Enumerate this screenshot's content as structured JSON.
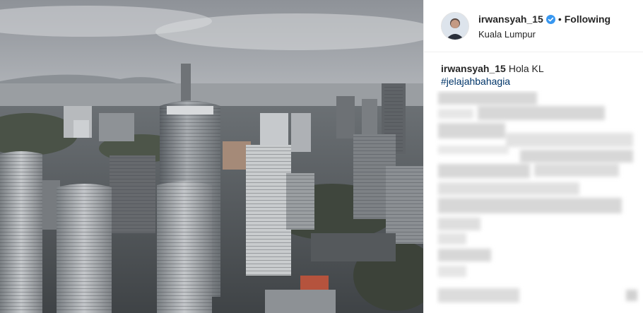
{
  "post": {
    "username": "irwansyah_15",
    "separator": "•",
    "follow_status": "Following",
    "location": "Kuala Lumpur",
    "caption": {
      "username": "irwansyah_15",
      "text": "Hola KL",
      "hashtag": "#jelajahbahagia"
    },
    "icons": {
      "verified": "verified-badge-icon",
      "avatar": "profile-avatar"
    },
    "colors": {
      "verified": "#3897f0",
      "hashtag": "#003569",
      "text": "#262626",
      "border": "#efefef"
    }
  }
}
